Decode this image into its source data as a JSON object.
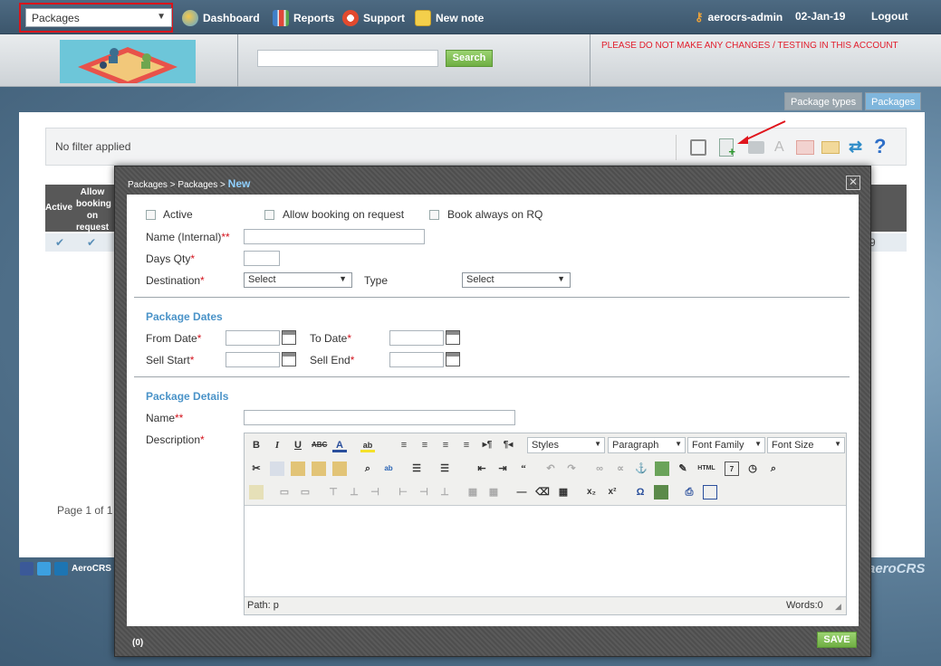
{
  "topbar": {
    "package_select": "Packages",
    "nav": [
      {
        "label": "Dashboard",
        "icon": "dashboard-icon",
        "color": "#e9a52b"
      },
      {
        "label": "Reports",
        "icon": "reports-icon",
        "color": "#4c8ad0"
      },
      {
        "label": "Support",
        "icon": "support-icon",
        "color": "#e24a2e"
      },
      {
        "label": "New note",
        "icon": "new-note-icon",
        "color": "#f3cf4b"
      }
    ],
    "user": "aerocrs-admin",
    "date": "02-Jan-19",
    "logout": "Logout"
  },
  "header": {
    "search_button": "Search",
    "warning": "PLEASE DO NOT MAKE ANY CHANGES / TESTING IN THIS ACCOUNT"
  },
  "tabs": {
    "package_types": "Package types",
    "packages": "Packages"
  },
  "list": {
    "filter_text": "No filter applied",
    "columns": [
      "Active",
      "Allow booking on request"
    ],
    "row_tail": "9",
    "page_text": "Page 1 of 1"
  },
  "footer": {
    "company": "AeroCRS",
    "brand": "aeroCRS"
  },
  "modal": {
    "breadcrumb": [
      "Packages",
      "Packages"
    ],
    "breadcrumb_current": "New",
    "checkboxes": {
      "active": "Active",
      "allow_booking": "Allow booking on request",
      "book_always": "Book always on RQ"
    },
    "labels": {
      "name_internal": "Name (Internal)",
      "days_qty": "Days Qty",
      "destination": "Destination",
      "type": "Type",
      "from_date": "From Date",
      "to_date": "To Date",
      "sell_start": "Sell Start",
      "sell_end": "Sell End",
      "name": "Name",
      "description": "Description"
    },
    "required_double": "**",
    "required_single": "*",
    "destination_value": "Select",
    "type_value": "Select",
    "sections": {
      "dates": "Package Dates",
      "details": "Package Details"
    },
    "editor": {
      "styles": "Styles",
      "paragraph": "Paragraph",
      "font_family": "Font Family",
      "font_size": "Font Size",
      "path": "Path: p",
      "words": "Words:0",
      "html_btn": "HTML"
    },
    "save": "SAVE",
    "counter": "(0)"
  }
}
